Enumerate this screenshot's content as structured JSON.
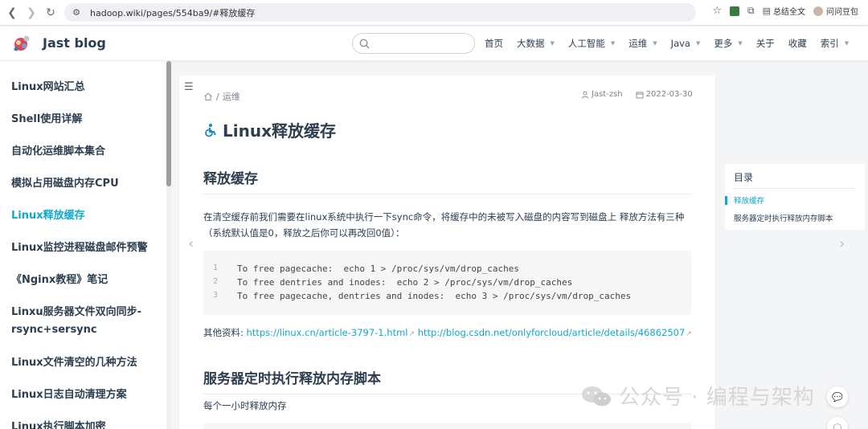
{
  "browser": {
    "url": "hadoop.wiki/pages/554ba9/#释放缓存",
    "ext_label": "总结全文",
    "profile_label": "问问豆包"
  },
  "header": {
    "site_title": "Jast blog",
    "search_placeholder": "",
    "nav": [
      {
        "label": "首页",
        "dropdown": false
      },
      {
        "label": "大数据",
        "dropdown": true
      },
      {
        "label": "人工智能",
        "dropdown": true
      },
      {
        "label": "运维",
        "dropdown": true
      },
      {
        "label": "Java",
        "dropdown": true
      },
      {
        "label": "更多",
        "dropdown": true
      },
      {
        "label": "关于",
        "dropdown": false
      },
      {
        "label": "收藏",
        "dropdown": false
      },
      {
        "label": "索引",
        "dropdown": true
      }
    ]
  },
  "sidebar": {
    "items": [
      {
        "label": "Linux网站汇总"
      },
      {
        "label": "Shell使用详解"
      },
      {
        "label": "自动化运维脚本集合"
      },
      {
        "label": "模拟占用磁盘内存CPU"
      },
      {
        "label": "Linux释放缓存",
        "active": true
      },
      {
        "label": "Linux监控进程磁盘邮件预警"
      },
      {
        "label": "《Nginx教程》笔记"
      },
      {
        "label": "Linxu服务器文件双向同步-rsync+sersync"
      },
      {
        "label": "Linux文件清空的几种方法"
      },
      {
        "label": "Linux日志自动清理方案"
      },
      {
        "label": "Linux执行脚本加密"
      }
    ]
  },
  "article": {
    "breadcrumb": "运维",
    "author": "Jast-zsh",
    "date": "2022-03-30",
    "title": "Linux释放缓存",
    "section1_heading": "释放缓存",
    "section1_text": "在清空缓存前我们需要在linux系统中执行一下sync命令，将缓存中的未被写入磁盘的内容写到磁盘上 释放方法有三种（系统默认值是0，释放之后你可以再改回0值）：",
    "code_lines": [
      {
        "n": "1",
        "text": "To free pagecache:  echo 1 > /proc/sys/vm/drop_caches"
      },
      {
        "n": "2",
        "text": "To free dentries and inodes:  echo 2 > /proc/sys/vm/drop_caches"
      },
      {
        "n": "3",
        "text": "To free pagecache, dentries and inodes:  echo 3 > /proc/sys/vm/drop_caches"
      }
    ],
    "refs_label": "其他资料:",
    "ref1": "https://linux.cn/article-3797-1.html",
    "ref2": "http://blog.csdn.net/onlyforcloud/article/details/46862507",
    "section2_heading": "服务器定时执行释放内存脚本",
    "section2_text": "每个一小时释放内存"
  },
  "toc": {
    "title": "目录",
    "items": [
      {
        "label": "释放缓存",
        "active": true
      },
      {
        "label": "服务器定时执行释放内存脚本"
      }
    ]
  },
  "watermark": {
    "text": "公众号 · 编程与架构"
  },
  "colors": {
    "accent": "#11a8cd",
    "text": "#2c3e50"
  }
}
